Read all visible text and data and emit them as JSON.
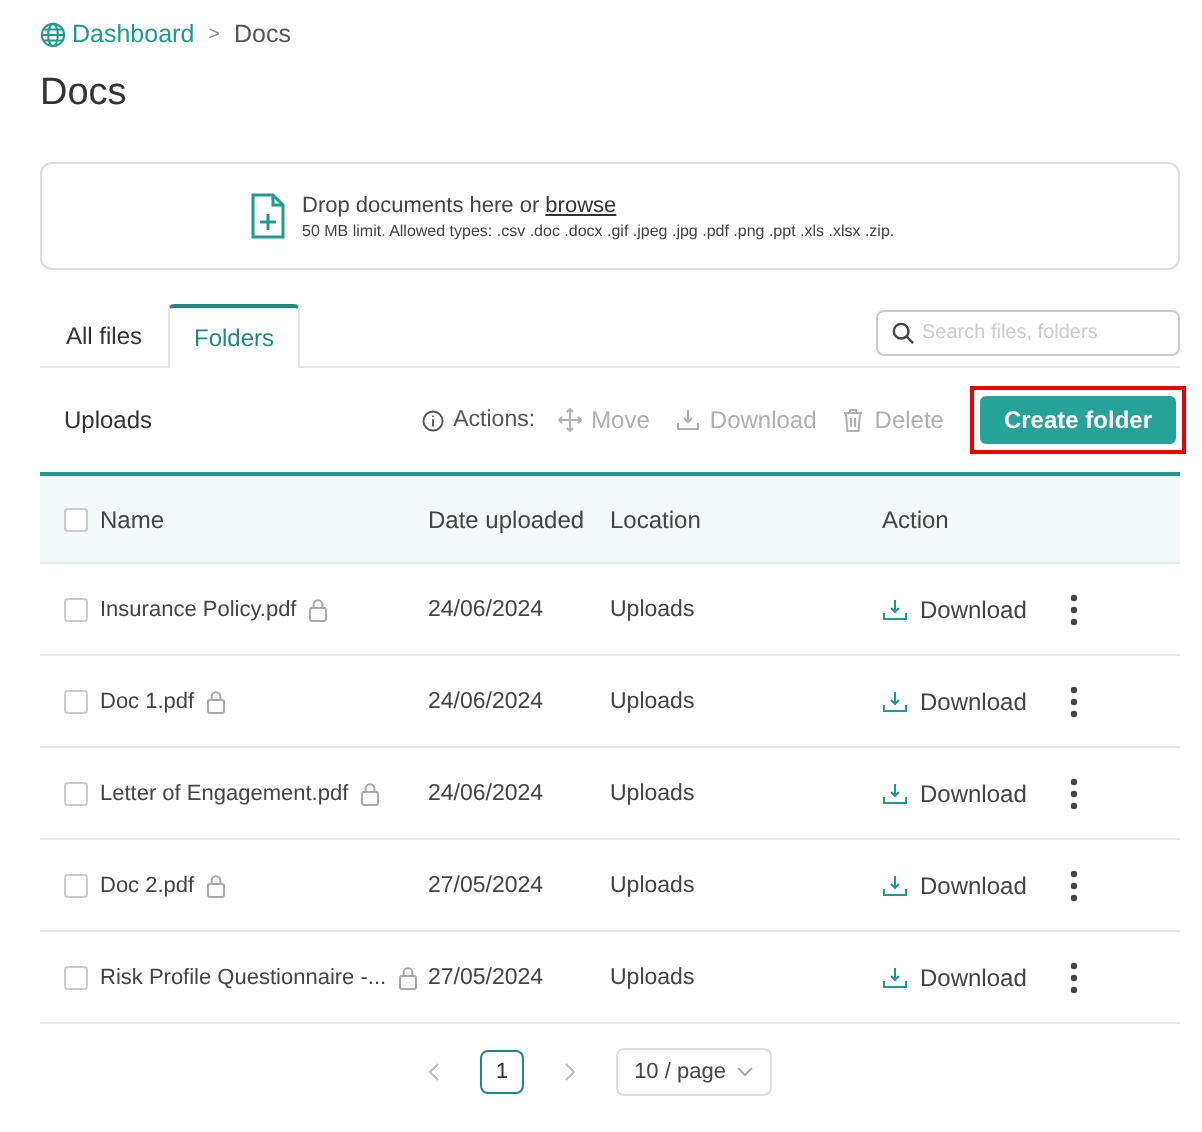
{
  "breadcrumb": [
    {
      "label": "Dashboard"
    },
    {
      "label": "Docs"
    }
  ],
  "breadcrumb_separator": ">",
  "title": "Docs",
  "dropzone": {
    "text_before": "Drop documents here or",
    "link": "browse",
    "hint": "50 MB limit. Allowed types: .csv .doc .docx .gif .jpeg .jpg .pdf .png .ppt .xls .xlsx .zip."
  },
  "tabs": [
    {
      "label": "All files",
      "selected": false
    },
    {
      "label": "Folders",
      "selected": true
    }
  ],
  "search": {
    "placeholder": "Search files, folders"
  },
  "toolbar": {
    "location": "Uploads",
    "actions_label": "Actions:",
    "actions": [
      {
        "label": "Move",
        "kind": "move",
        "disabled": true
      },
      {
        "label": "Download",
        "kind": "download",
        "disabled": true
      },
      {
        "label": "Delete",
        "kind": "delete",
        "disabled": true
      }
    ],
    "primary": "Create folder",
    "primary_highlighted": true
  },
  "table": {
    "all_checked": false,
    "columns": [
      "Name",
      "Date uploaded",
      "Location",
      "Action"
    ],
    "rows": [
      {
        "name": "Insurance Policy.pdf",
        "locked": true,
        "date": "24/06/2024",
        "location": "Uploads",
        "action": "Download",
        "checked": false
      },
      {
        "name": "Doc 1.pdf",
        "locked": true,
        "date": "24/06/2024",
        "location": "Uploads",
        "action": "Download",
        "checked": false
      },
      {
        "name": "Letter of Engagement.pdf",
        "locked": true,
        "date": "24/06/2024",
        "location": "Uploads",
        "action": "Download",
        "checked": false
      },
      {
        "name": "Doc 2.pdf",
        "locked": true,
        "date": "27/05/2024",
        "location": "Uploads",
        "action": "Download",
        "checked": false
      },
      {
        "name": "Risk Profile Questionnaire -...",
        "locked": true,
        "date": "27/05/2024",
        "location": "Uploads",
        "action": "Download",
        "checked": false
      }
    ]
  },
  "pagination": {
    "pages": [
      {
        "label": "1",
        "selected": true
      }
    ],
    "page_size": "10 / page"
  }
}
